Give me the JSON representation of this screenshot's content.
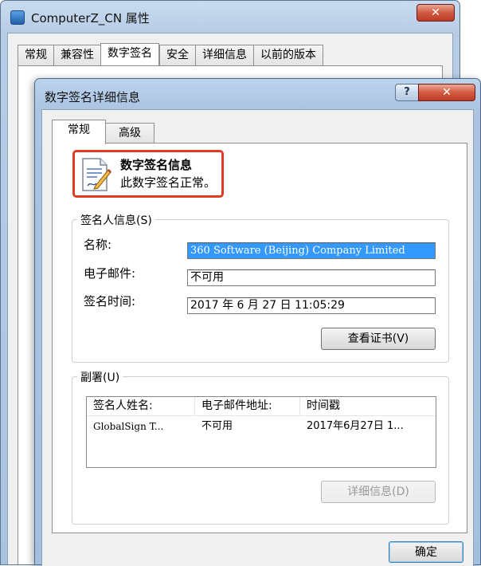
{
  "back_window": {
    "title": "ComputerZ_CN 属性",
    "close_label": "✕",
    "tabs": [
      "常规",
      "兼容性",
      "数字签名",
      "安全",
      "详细信息",
      "以前的版本"
    ]
  },
  "dialog": {
    "title": "数字签名详细信息",
    "help_label": "?",
    "close_label": "✕",
    "tabs": [
      "常规",
      "高级"
    ],
    "info": {
      "title": "数字签名信息",
      "subtitle": "此数字签名正常。"
    },
    "signer": {
      "legend": "签名人信息(S)",
      "name_label": "名称:",
      "name_value": "360 Software (Beijing) Company Limited",
      "email_label": "电子邮件:",
      "email_value": "不可用",
      "time_label": "签名时间:",
      "time_value": " 2017  年  6  月  27  日 11:05:29",
      "view_cert_label": "查看证书(V)"
    },
    "countersign": {
      "legend": "副署(U)",
      "columns": [
        "签名人姓名:",
        "电子邮件地址:",
        "时间戳"
      ],
      "rows": [
        [
          "GlobalSign T...",
          "不可用",
          "2017年6月27日 1..."
        ]
      ],
      "details_label": "详细信息(D)"
    },
    "ok_label": "确定"
  },
  "colors": {
    "highlight_border": "#e03a22",
    "selection": "#3399ff",
    "close_red": "#cf5a42"
  }
}
